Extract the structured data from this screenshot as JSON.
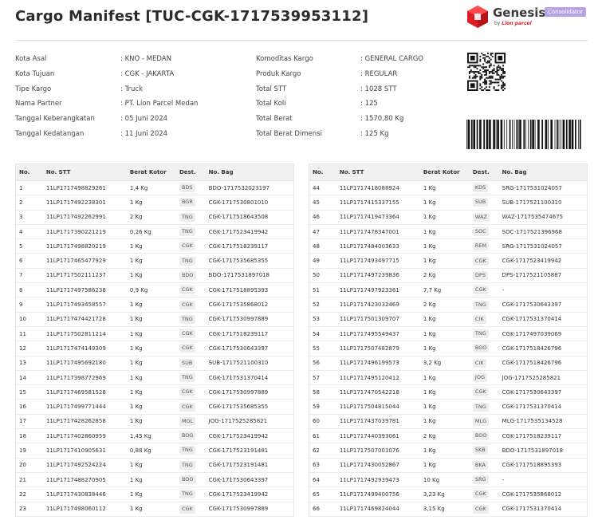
{
  "header": {
    "title": "Cargo Manifest [TUC-CGK-1717539953112]",
    "brand": "Genesis",
    "brand_sub_prefix": "by",
    "brand_sub_name": "Lion parcel",
    "badge": "Consolidator",
    "brand_color": "#e21b23",
    "badge_color": "#b8a1e6"
  },
  "info_left": [
    {
      "label": "Kota Asal",
      "value": ": KNO - MEDAN"
    },
    {
      "label": "Kota Tujuan",
      "value": ": CGK - JAKARTA"
    },
    {
      "label": "Tipe Kargo",
      "value": ": Truck"
    },
    {
      "label": "Nama Partner",
      "value": ": PT. Lion Parcel Medan"
    },
    {
      "label": "Tanggal Keberangkatan",
      "value": ": 05 Juni 2024"
    },
    {
      "label": "Tanggal Kedatangan",
      "value": ": 11 Juni 2024"
    }
  ],
  "info_right": [
    {
      "label": "Komoditas Kargo",
      "value": ": GENERAL CARGO"
    },
    {
      "label": "Produk Kargo",
      "value": ": REGULAR"
    },
    {
      "label": "Total STT",
      "value": ": 1028 STT"
    },
    {
      "label": "Total Koli",
      "value": ": 125"
    },
    {
      "label": "Total Berat",
      "value": ": 1570,80 Kg"
    },
    {
      "label": "Total Berat Dimensi",
      "value": ": 125 Kg"
    }
  ],
  "table_headers": {
    "no": "No.",
    "stt": "No. STT",
    "berat": "Berat Kotor",
    "dest": "Dest.",
    "bag": "No. Bag"
  },
  "table_left": [
    {
      "no": "1",
      "stt": "11LP1717498829261",
      "berat": "1,4 Kg",
      "dest": "BDS",
      "bag": "BDO-1717532023197"
    },
    {
      "no": "2",
      "stt": "11LP1717492238301",
      "berat": "1 Kg",
      "dest": "BGR",
      "bag": "CGK-1717530801010"
    },
    {
      "no": "3",
      "stt": "11LP1717492262991",
      "berat": "2 Kg",
      "dest": "TNG",
      "bag": "CGK-1717518643508"
    },
    {
      "no": "4",
      "stt": "11LP1717390221219",
      "berat": "0,26 Kg",
      "dest": "TNG",
      "bag": "CGK-1717523419942"
    },
    {
      "no": "5",
      "stt": "11LP1717498820219",
      "berat": "1 Kg",
      "dest": "CGK",
      "bag": "CGK-1717518239117"
    },
    {
      "no": "6",
      "stt": "11LP1717465477929",
      "berat": "1 Kg",
      "dest": "TNG",
      "bag": "CGK-1717535685355"
    },
    {
      "no": "7",
      "stt": "11LP1717502111237",
      "berat": "1 Kg",
      "dest": "BDO",
      "bag": "BDO-1717531897018"
    },
    {
      "no": "8",
      "stt": "11LP1717497586238",
      "berat": "0,9 Kg",
      "dest": "CGK",
      "bag": "CGK-1717518895393"
    },
    {
      "no": "9",
      "stt": "11LP1717493458557",
      "berat": "1 Kg",
      "dest": "CGK",
      "bag": "CGK-1717535868012"
    },
    {
      "no": "10",
      "stt": "11LP1717474421728",
      "berat": "1 Kg",
      "dest": "TNG",
      "bag": "CGK-1717530997889"
    },
    {
      "no": "11",
      "stt": "11LP1717502811214",
      "berat": "1 Kg",
      "dest": "CGK",
      "bag": "CGK-1717518239117"
    },
    {
      "no": "12",
      "stt": "11LP1717474149309",
      "berat": "1 Kg",
      "dest": "CGK",
      "bag": "CGK-1717530643397"
    },
    {
      "no": "13",
      "stt": "11LP1717495692180",
      "berat": "1 Kg",
      "dest": "SUB",
      "bag": "SUB-1717521100310"
    },
    {
      "no": "14",
      "stt": "11LP1717398772969",
      "berat": "1 Kg",
      "dest": "TNG",
      "bag": "CGK-1717531370414"
    },
    {
      "no": "15",
      "stt": "11LP1717469581528",
      "berat": "1 Kg",
      "dest": "CGK",
      "bag": "CGK-1717530997889"
    },
    {
      "no": "16",
      "stt": "11LP1717499771444",
      "berat": "1 Kg",
      "dest": "CGK",
      "bag": "CGK-1717535685355"
    },
    {
      "no": "17",
      "stt": "11LP1717428262858",
      "berat": "1 Kg",
      "dest": "MGL",
      "bag": "JOG-1717525285821"
    },
    {
      "no": "18",
      "stt": "11LP1717402860959",
      "berat": "1,45 Kg",
      "dest": "BOG",
      "bag": "CGK-1717523419942"
    },
    {
      "no": "19",
      "stt": "11LP1717410905631",
      "berat": "0,88 Kg",
      "dest": "TNG",
      "bag": "CGK-1717523191481"
    },
    {
      "no": "20",
      "stt": "11LP1717492524224",
      "berat": "1 Kg",
      "dest": "TNG",
      "bag": "CGK-1717523191481"
    },
    {
      "no": "21",
      "stt": "11LP1717488270905",
      "berat": "1 Kg",
      "dest": "BOO",
      "bag": "CGK-1717530643397"
    },
    {
      "no": "22",
      "stt": "11LP1717430838446",
      "berat": "1 Kg",
      "dest": "TNG",
      "bag": "CGK-1717523419942"
    },
    {
      "no": "23",
      "stt": "11LP1717498060112",
      "berat": "1 Kg",
      "dest": "CGK",
      "bag": "CGK-1717530997889"
    }
  ],
  "table_right": [
    {
      "no": "44",
      "stt": "11LP1717418088924",
      "berat": "1 Kg",
      "dest": "KDS",
      "bag": "SRG-1717531024057"
    },
    {
      "no": "45",
      "stt": "11LP1717415337155",
      "berat": "1 Kg",
      "dest": "SUB",
      "bag": "SUB-1717521100310"
    },
    {
      "no": "46",
      "stt": "11LP1717419473364",
      "berat": "1 Kg",
      "dest": "WAZ",
      "bag": "WAZ-1717535474675"
    },
    {
      "no": "47",
      "stt": "11LP1717478347001",
      "berat": "1 Kg",
      "dest": "SOC",
      "bag": "SOC-1717521396968"
    },
    {
      "no": "48",
      "stt": "11LP1717484003633",
      "berat": "1 Kg",
      "dest": "REM",
      "bag": "SRG-1717531024057"
    },
    {
      "no": "49",
      "stt": "11LP1717493497715",
      "berat": "1 Kg",
      "dest": "CGK",
      "bag": "CGK-1717523419942"
    },
    {
      "no": "50",
      "stt": "11LP1717497239836",
      "berat": "2 Kg",
      "dest": "DPS",
      "bag": "DPS-1717521105887"
    },
    {
      "no": "51",
      "stt": "11LP1717497923361",
      "berat": "7,7 Kg",
      "dest": "CGK",
      "bag": "-"
    },
    {
      "no": "52",
      "stt": "11LP1717423032469",
      "berat": "2 Kg",
      "dest": "TNG",
      "bag": "CGK-1717530643397"
    },
    {
      "no": "53",
      "stt": "11LP1717501309707",
      "berat": "1 Kg",
      "dest": "CIK",
      "bag": "CGK-1717531370414"
    },
    {
      "no": "54",
      "stt": "11LP1717495549437",
      "berat": "1 Kg",
      "dest": "TNG",
      "bag": "CGK-1717497039069"
    },
    {
      "no": "55",
      "stt": "11LP1717507482879",
      "berat": "1 Kg",
      "dest": "BOO",
      "bag": "CGK-1717518426796"
    },
    {
      "no": "56",
      "stt": "11LP1717496199573",
      "berat": "3,2 Kg",
      "dest": "CIK",
      "bag": "CGK-1717518426796"
    },
    {
      "no": "57",
      "stt": "11LP1717495120412",
      "berat": "1 Kg",
      "dest": "JOG",
      "bag": "JOG-1717525285821"
    },
    {
      "no": "58",
      "stt": "11LP1717470542218",
      "berat": "1 Kg",
      "dest": "CGK",
      "bag": "CGK-1717530643397"
    },
    {
      "no": "59",
      "stt": "11LP1717504815044",
      "berat": "1 Kg",
      "dest": "TNG",
      "bag": "CGK-1717531370414"
    },
    {
      "no": "60",
      "stt": "11LP1717437039781",
      "berat": "1 Kg",
      "dest": "MLG",
      "bag": "MLG-1717535134528"
    },
    {
      "no": "61",
      "stt": "11LP1717440393061",
      "berat": "2 Kg",
      "dest": "BOO",
      "bag": "CGK-1717518239117"
    },
    {
      "no": "62",
      "stt": "11LP1717507001076",
      "berat": "1 Kg",
      "dest": "SKB",
      "bag": "BDO-1717531897018"
    },
    {
      "no": "63",
      "stt": "11LP1717430052867",
      "berat": "1 Kg",
      "dest": "BKA",
      "bag": "CGK-1717518895393"
    },
    {
      "no": "64",
      "stt": "11LP1717492939473",
      "berat": "10 Kg",
      "dest": "SRG",
      "bag": "-"
    },
    {
      "no": "65",
      "stt": "11LP1717499400756",
      "berat": "3,23 Kg",
      "dest": "CGK",
      "bag": "CGK-1717535868012"
    },
    {
      "no": "66",
      "stt": "11LP1717469824044",
      "berat": "3,15 Kg",
      "dest": "CGK",
      "bag": "CGK-1717531370414"
    }
  ]
}
